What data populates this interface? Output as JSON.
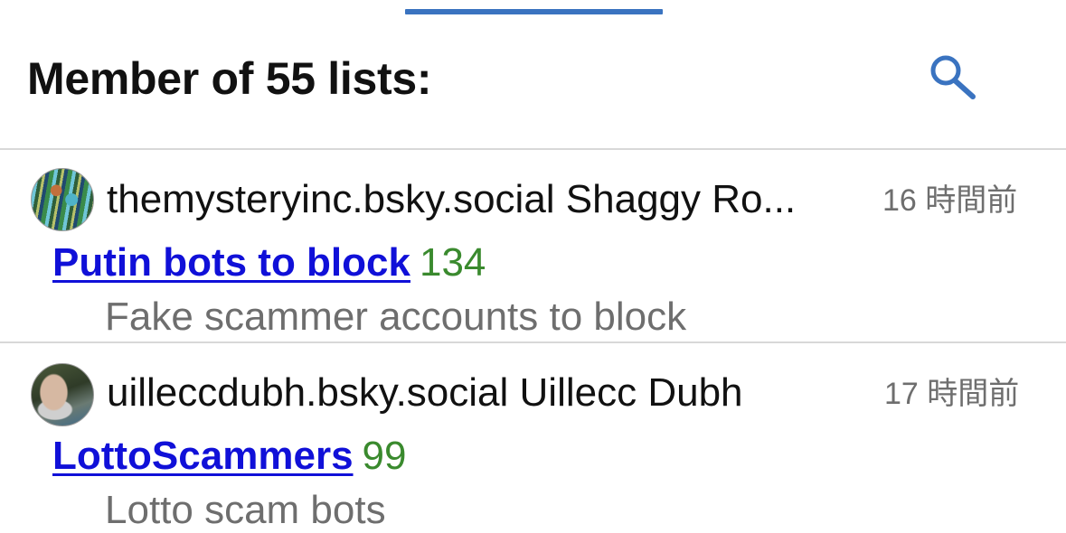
{
  "header": {
    "title": "Member of 55 lists:",
    "search_icon": "search-icon",
    "accent_color": "#3a73c0"
  },
  "lists": [
    {
      "account": "themysteryinc.bsky.social Shaggy Ro...",
      "time": "16 時間前",
      "title": "Putin bots to block",
      "count": "134",
      "description": "Fake scammer accounts to block"
    },
    {
      "account": "uilleccdubh.bsky.social Uillecc Dubh",
      "time": "17 時間前",
      "title": "LottoScammers",
      "count": "99",
      "description": "Lotto scam bots"
    }
  ],
  "colors": {
    "link": "#1010d8",
    "count": "#3a8a2e",
    "muted": "#6e6e6e"
  }
}
